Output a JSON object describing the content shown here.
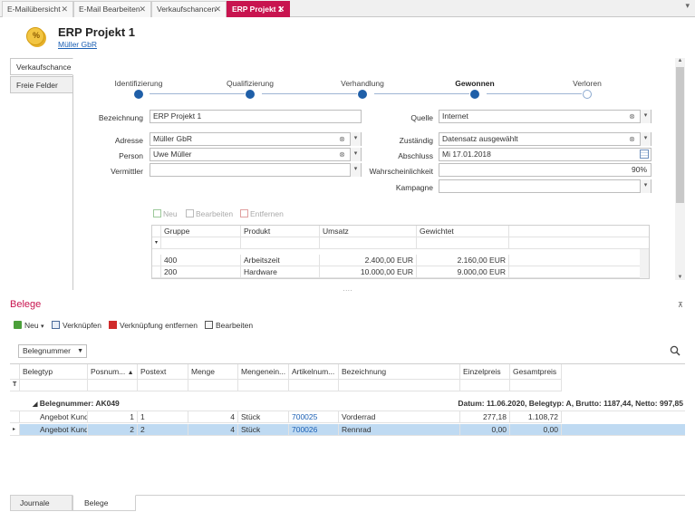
{
  "tabs": [
    {
      "label": "E-Mailübersicht",
      "close": "✕"
    },
    {
      "label": "E-Mail Bearbeiten",
      "close": "✕"
    },
    {
      "label": "Verkaufschancen",
      "close": "✕"
    },
    {
      "label": "ERP Projekt 1",
      "close": "✕"
    }
  ],
  "header": {
    "icon_text": "%",
    "title": "ERP Projekt 1",
    "company_link": "Müller GbR"
  },
  "side_tabs": [
    "Verkaufschance",
    "Freie Felder"
  ],
  "pipeline": {
    "stages": [
      "Identifizierung",
      "Qualifizierung",
      "Verhandlung",
      "Gewonnen",
      "Verloren"
    ],
    "current": "Gewonnen",
    "completed": [
      true,
      true,
      true,
      true,
      false
    ]
  },
  "form": {
    "bezeichnung": {
      "label": "Bezeichnung",
      "value": "ERP Projekt 1"
    },
    "adresse": {
      "label": "Adresse",
      "value": "Müller GbR"
    },
    "person": {
      "label": "Person",
      "value": "Uwe Müller"
    },
    "vermittler": {
      "label": "Vermittler",
      "value": ""
    },
    "quelle": {
      "label": "Quelle",
      "value": "Internet"
    },
    "zustaendig": {
      "label": "Zuständig",
      "value": "Datensatz ausgewählt"
    },
    "abschluss": {
      "label": "Abschluss",
      "value": "Mi 17.01.2018"
    },
    "wahrscheinlichkeit": {
      "label": "Wahrscheinlichkeit",
      "value": "90%"
    },
    "kampagne": {
      "label": "Kampagne",
      "value": ""
    }
  },
  "position_toolbar": {
    "new": "Neu",
    "edit": "Bearbeiten",
    "remove": "Entfernen"
  },
  "position_grid": {
    "columns": [
      "Gruppe",
      "Produkt",
      "Umsatz",
      "Gewichtet"
    ],
    "filter_marker": "▾",
    "rows": [
      {
        "gruppe": "400",
        "produkt": "Arbeitszeit",
        "umsatz": "2.400,00 EUR",
        "gewichtet": "2.160,00 EUR"
      },
      {
        "gruppe": "200",
        "produkt": "Hardware",
        "umsatz": "10.000,00 EUR",
        "gewichtet": "9.000,00 EUR"
      }
    ]
  },
  "splitter_grip": "····",
  "belege": {
    "title": "Belege",
    "pin": "⊼",
    "toolbar": {
      "new": "Neu",
      "link": "Verknüpfen",
      "unlink": "Verknüpfung entfernen",
      "edit": "Bearbeiten"
    },
    "group_field": "Belegnummer",
    "columns": [
      "Belegtyp",
      "Posnum...",
      "Postext",
      "Menge",
      "Mengenein...",
      "Artikelnum...",
      "Bezeichnung",
      "Einzelpreis",
      "Gesamtpreis"
    ],
    "filter_marker": "T",
    "group_row": {
      "title": "Belegnummer: AK049",
      "summary": "Datum: 11.06.2020,  Belegtyp: A,  Brutto: 1187,44,  Netto: 997,85"
    },
    "rows": [
      {
        "belegtyp": "Angebot Kund",
        "posnum": "1",
        "postext": "1",
        "menge": "4",
        "einheit": "Stück",
        "artikel": "700025",
        "bezeichnung": "Vorderrad",
        "einzelpreis": "277,18",
        "gesamtpreis": "1.108,72"
      },
      {
        "belegtyp": "Angebot Kund",
        "posnum": "2",
        "postext": "2",
        "menge": "4",
        "einheit": "Stück",
        "artikel": "700026",
        "bezeichnung": "Rennrad",
        "einzelpreis": "0,00",
        "gesamtpreis": "0,00"
      }
    ]
  },
  "bottom_tabs": [
    "Journale",
    "Belege"
  ]
}
